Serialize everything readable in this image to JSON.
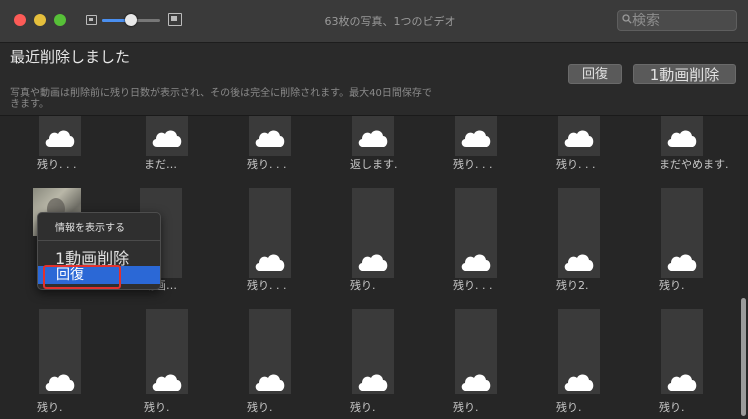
{
  "window": {
    "title": "63枚の写真、1つのビデオ"
  },
  "search": {
    "placeholder": "検索"
  },
  "zoom": {
    "level": 0.5
  },
  "header": {
    "title": "最近削除しました",
    "description": "写真や動画は削除前に残り日数が表示され、その後は完全に削除されます。最大40日間保存できます。",
    "recover_label": "回復",
    "delete_label": "1動画削除"
  },
  "grid": {
    "rows": [
      [
        "残り. . .",
        "まだ…",
        "残り. . .",
        "返します.",
        "残り. . .",
        "残り. . .",
        "まだやめます."
      ],
      [
        "",
        "",
        "残り. . .",
        "残り.",
        "残り. . .",
        "残り2.",
        "残り."
      ],
      [
        "残り.",
        "残り.",
        "残り.",
        "残り.",
        "残り.",
        "残り.",
        "残り."
      ]
    ],
    "photo_cell_label": "1動画…"
  },
  "context_menu": {
    "info": "情報を表示する",
    "delete": "1動画削除",
    "recover": "回復"
  }
}
